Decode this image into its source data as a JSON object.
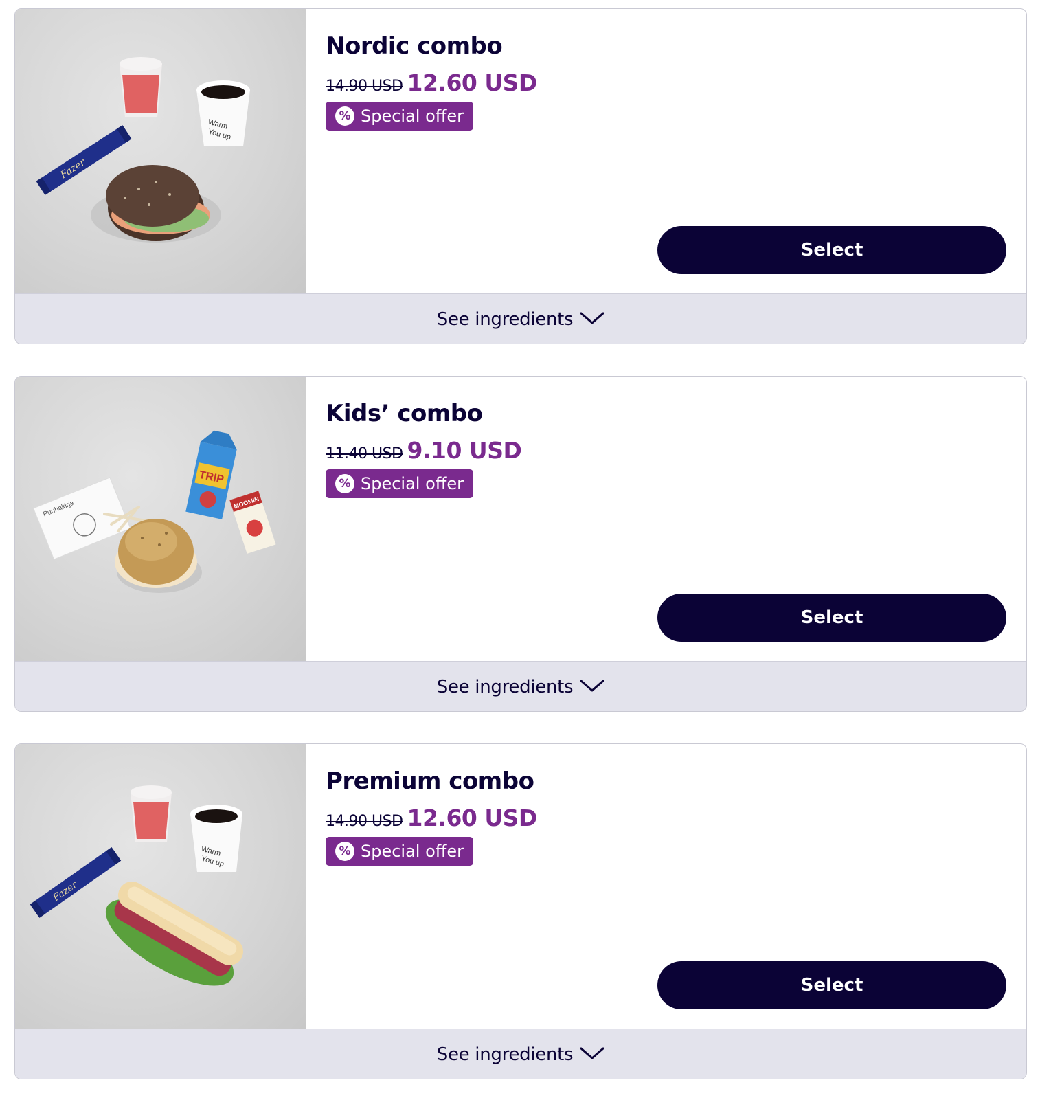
{
  "colors": {
    "brand_navy": "#0b0336",
    "offer_purple": "#7a2a8e",
    "ingredients_bg": "#e3e3ec"
  },
  "offers": [
    {
      "title": "Nordic combo",
      "old_price": "14.90 USD",
      "new_price": "12.60 USD",
      "badge_icon": "%",
      "badge_label": "Special offer",
      "select_label": "Select",
      "ingredients_label": "See ingredients",
      "image_icon": "nordic-combo-photo"
    },
    {
      "title": "Kids’ combo",
      "old_price": "11.40 USD",
      "new_price": "9.10 USD",
      "badge_icon": "%",
      "badge_label": "Special offer",
      "select_label": "Select",
      "ingredients_label": "See ingredients",
      "image_icon": "kids-combo-photo"
    },
    {
      "title": "Premium combo",
      "old_price": "14.90 USD",
      "new_price": "12.60 USD",
      "badge_icon": "%",
      "badge_label": "Special offer",
      "select_label": "Select",
      "ingredients_label": "See ingredients",
      "image_icon": "premium-combo-photo"
    }
  ]
}
